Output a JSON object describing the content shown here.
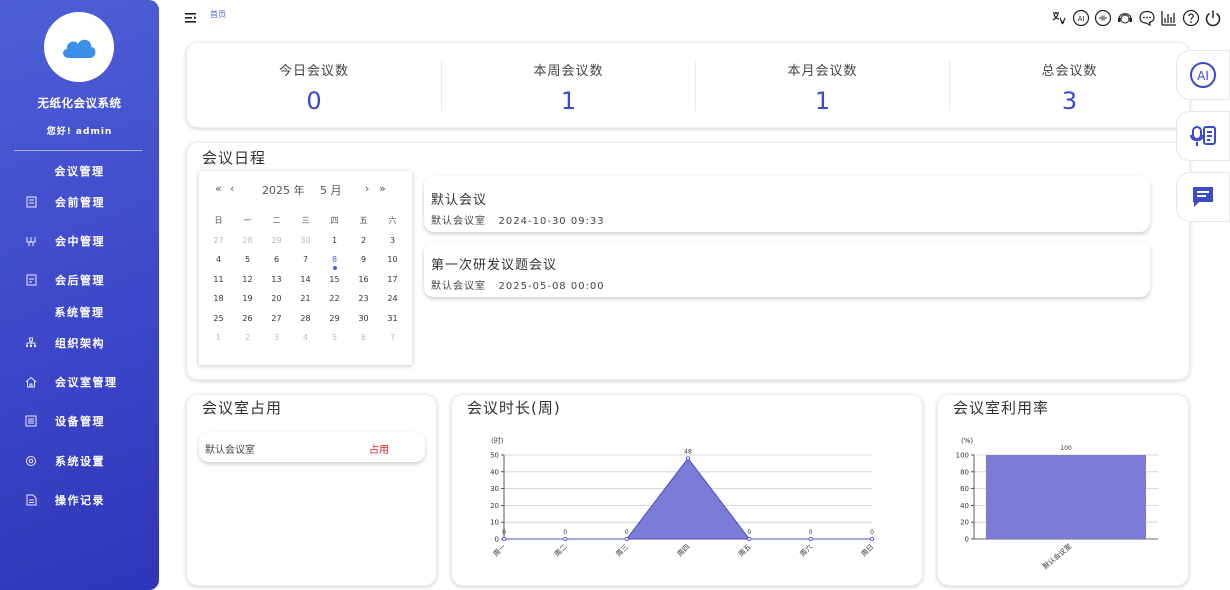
{
  "sidebar": {
    "system_name": "无纸化会议系统",
    "greeting": "您好! admin",
    "groups": [
      {
        "label": "会议管理"
      },
      {
        "label": "系统管理"
      }
    ],
    "items": [
      {
        "label": "会前管理",
        "icon": "calendar-doc-icon"
      },
      {
        "label": "会中管理",
        "icon": "meeting-icon"
      },
      {
        "label": "会后管理",
        "icon": "archive-icon"
      },
      {
        "label": "组织架构",
        "icon": "org-tree-icon"
      },
      {
        "label": "会议室管理",
        "icon": "home-icon"
      },
      {
        "label": "设备管理",
        "icon": "device-icon"
      },
      {
        "label": "系统设置",
        "icon": "gear-icon"
      },
      {
        "label": "操作记录",
        "icon": "log-icon"
      }
    ]
  },
  "header": {
    "breadcrumb": "首页",
    "icons": [
      "translate-icon",
      "ai-icon",
      "voice-icon",
      "support-icon",
      "chat-icon",
      "stats-icon",
      "help-icon",
      "power-icon"
    ]
  },
  "stats": [
    {
      "label": "今日会议数",
      "value": "0"
    },
    {
      "label": "本周会议数",
      "value": "1"
    },
    {
      "label": "本月会议数",
      "value": "1"
    },
    {
      "label": "总会议数",
      "value": "3"
    }
  ],
  "schedule": {
    "title": "会议日程",
    "calendar": {
      "year_label": "2025 年",
      "month_label": "5 月",
      "weekdays": [
        "日",
        "一",
        "二",
        "三",
        "四",
        "五",
        "六"
      ],
      "weeks": [
        [
          "27",
          "28",
          "29",
          "30",
          "1",
          "2",
          "3"
        ],
        [
          "4",
          "5",
          "6",
          "7",
          "8",
          "9",
          "10"
        ],
        [
          "11",
          "12",
          "13",
          "14",
          "15",
          "16",
          "17"
        ],
        [
          "18",
          "19",
          "20",
          "21",
          "22",
          "23",
          "24"
        ],
        [
          "25",
          "26",
          "27",
          "28",
          "29",
          "30",
          "31"
        ],
        [
          "1",
          "2",
          "3",
          "4",
          "5",
          "6",
          "7"
        ]
      ]
    },
    "meetings": [
      {
        "title": "默认会议",
        "room": "默认会议室",
        "time": "2024-10-30 09:33"
      },
      {
        "title": "第一次研发议题会议",
        "room": "默认会议室",
        "time": "2025-05-08 00:00"
      }
    ]
  },
  "occupancy": {
    "title": "会议室占用",
    "rooms": [
      {
        "name": "默认会议室",
        "status": "占用"
      }
    ]
  },
  "chart_data": [
    {
      "type": "area",
      "title": "会议时长(周)",
      "ylabel": "(时)",
      "categories": [
        "周一",
        "周二",
        "周三",
        "周四",
        "周五",
        "周六",
        "周日"
      ],
      "values": [
        0,
        0,
        0,
        48,
        0,
        0,
        0
      ],
      "ylim": [
        0,
        50
      ],
      "yticks": [
        0,
        10,
        20,
        30,
        40,
        50
      ],
      "color": "#7b7bd8",
      "grid": true
    },
    {
      "type": "bar",
      "title": "会议室利用率",
      "ylabel": "(%)",
      "categories": [
        "默认会议室"
      ],
      "values": [
        100
      ],
      "ylim": [
        0,
        100
      ],
      "yticks": [
        0,
        20,
        40,
        60,
        80,
        100
      ],
      "color": "#7b7bd8",
      "grid": true
    }
  ],
  "side_actions": [
    "ai-assistant-icon",
    "voice-record-icon",
    "message-icon"
  ],
  "colors": {
    "sidebar": "#3d47c9",
    "accent": "#3b4bc8",
    "chart": "#7b7bd8",
    "occupied": "#e02020"
  }
}
